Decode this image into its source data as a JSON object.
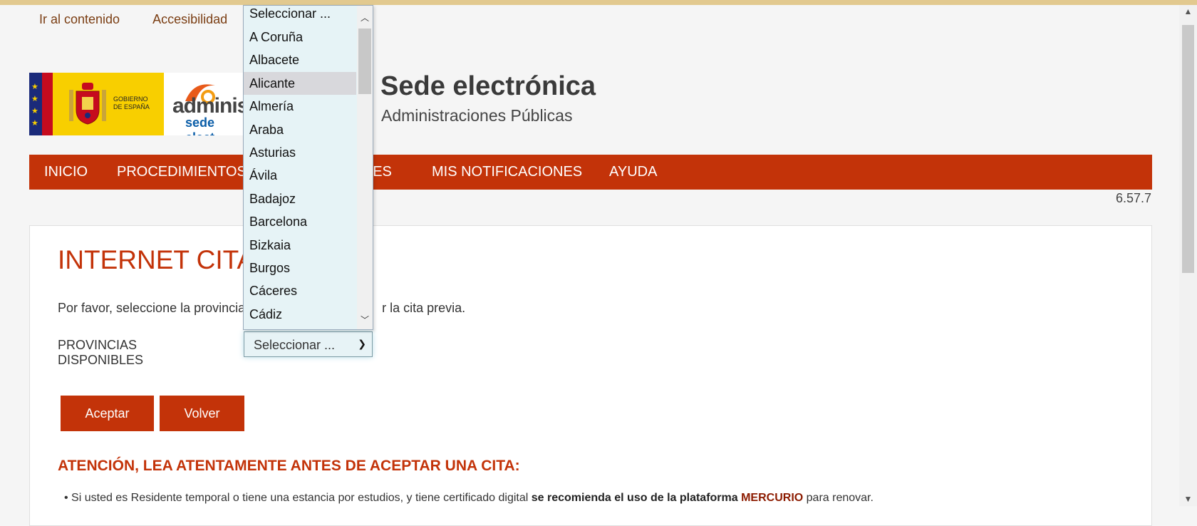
{
  "skip_links": [
    "Ir al contenido",
    "Accesibilidad"
  ],
  "header": {
    "logo_gobierno_text": [
      "GOBIERNO",
      "DE ESPAÑA"
    ],
    "logo_admin_text": [
      "adminis",
      "sede elect"
    ],
    "title": "Sede electrónica",
    "subtitle": "Administraciones Públicas"
  },
  "nav": {
    "items": [
      "INICIO",
      "PROCEDIMIENTOS",
      "TES",
      "MIS NOTIFICACIONES",
      "AYUDA"
    ],
    "color": "#c33309"
  },
  "version": "6.57.7",
  "main": {
    "title": "INTERNET CITA",
    "intro_left": "Por favor, seleccione la provincia",
    "intro_right": "r la cita previa.",
    "provinces_label": "PROVINCIAS DISPONIBLES",
    "select_value": "Seleccionar ...",
    "accept_button": "Aceptar",
    "back_button": "Volver",
    "attention": "ATENCIÓN, LEA ATENTAMENTE ANTES DE ACEPTAR UNA CITA:",
    "bullet_text_1": "Si usted es Residente temporal o tiene una estancia por estudios, y tiene certificado digital ",
    "bullet_bold": "se recomienda el uso de la plataforma ",
    "bullet_link": "MERCURIO",
    "bullet_text_2": " para renovar."
  },
  "dropdown": {
    "options": [
      "Seleccionar ...",
      "A Coruña",
      "Albacete",
      "Alicante",
      "Almería",
      "Araba",
      "Asturias",
      "Ávila",
      "Badajoz",
      "Barcelona",
      "Bizkaia",
      "Burgos",
      "Cáceres",
      "Cádiz"
    ],
    "highlighted": "Alicante"
  }
}
